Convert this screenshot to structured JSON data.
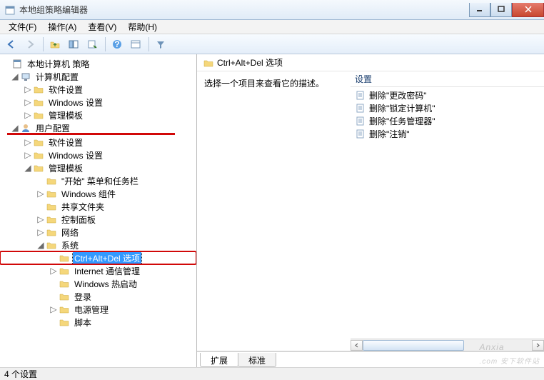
{
  "window": {
    "title": "本地组策略编辑器"
  },
  "menu": {
    "file": "文件(F)",
    "action": "操作(A)",
    "view": "查看(V)",
    "help": "帮助(H)"
  },
  "tree": {
    "root": "本地计算机 策略",
    "computer_config": "计算机配置",
    "cc_software": "软件设置",
    "cc_windows": "Windows 设置",
    "cc_admin": "管理模板",
    "user_config": "用户配置",
    "uc_software": "软件设置",
    "uc_windows": "Windows 设置",
    "uc_admin": "管理模板",
    "start_taskbar": "\"开始\" 菜单和任务栏",
    "win_components": "Windows 组件",
    "shared_folders": "共享文件夹",
    "control_panel": "控制面板",
    "network": "网络",
    "system": "系统",
    "ctrl_alt_del": "Ctrl+Alt+Del 选项",
    "internet_comm": "Internet 通信管理",
    "win_hotstart": "Windows 热启动",
    "logon": "登录",
    "power_management": "电源管理",
    "scripts": "脚本"
  },
  "detail": {
    "header": "Ctrl+Alt+Del 选项",
    "description": "选择一个项目来查看它的描述。",
    "column_setting": "设置",
    "items": {
      "change_password": "删除\"更改密码\"",
      "lock_computer": "删除\"锁定计算机\"",
      "task_manager": "删除\"任务管理器\"",
      "logoff": "删除\"注销\""
    },
    "tab_extended": "扩展",
    "tab_standard": "标准"
  },
  "status": {
    "count": "4 个设置"
  },
  "watermark": {
    "main": "Anxia",
    "sub": ".com 安下软件站"
  }
}
